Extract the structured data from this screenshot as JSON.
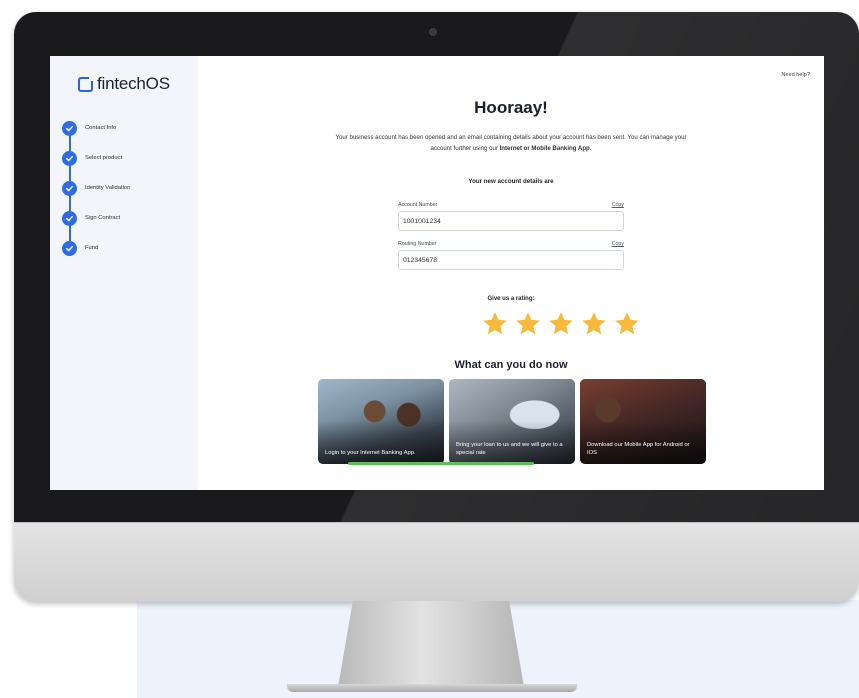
{
  "sidebar": {
    "logo_text": "fintechOS",
    "steps": [
      {
        "label": "Contact Info",
        "status": "done"
      },
      {
        "label": "Select product",
        "status": "done"
      },
      {
        "label": "Identity Validation",
        "status": "done"
      },
      {
        "label": "Sign Contract",
        "status": "done"
      },
      {
        "label": "Fund",
        "status": "done"
      }
    ]
  },
  "header": {
    "help_link": "Need help?"
  },
  "main": {
    "title": "Hooraay!",
    "intro_text": "Your business account has been opened and an email containing details about your account has been sent. You can manage your account further using our ",
    "intro_emphasis": "Internet or Mobile Banking App",
    "intro_end": ".",
    "details_heading": "Your new account details are",
    "account_number": {
      "label": "Account Number",
      "copy": "Copy",
      "value": "1001001234"
    },
    "routing_number": {
      "label": "Routing Number",
      "copy": "Copy",
      "value": "012345678"
    },
    "rating_label": "Give us a rating:",
    "rating": {
      "value": 5,
      "max": 5
    },
    "what_now_heading": "What can you do now",
    "cards": [
      {
        "text": "Login to your Internet Banking App."
      },
      {
        "text": "Bring your loan to us and we will give to a special rate"
      },
      {
        "text": "Download our Mobile App for Android or IOS"
      }
    ]
  },
  "colors": {
    "accent": "#2f6be8",
    "star": "#f6b93b",
    "progress": "#5cbf5a",
    "sidebar_bg": "#f3f5fa"
  }
}
